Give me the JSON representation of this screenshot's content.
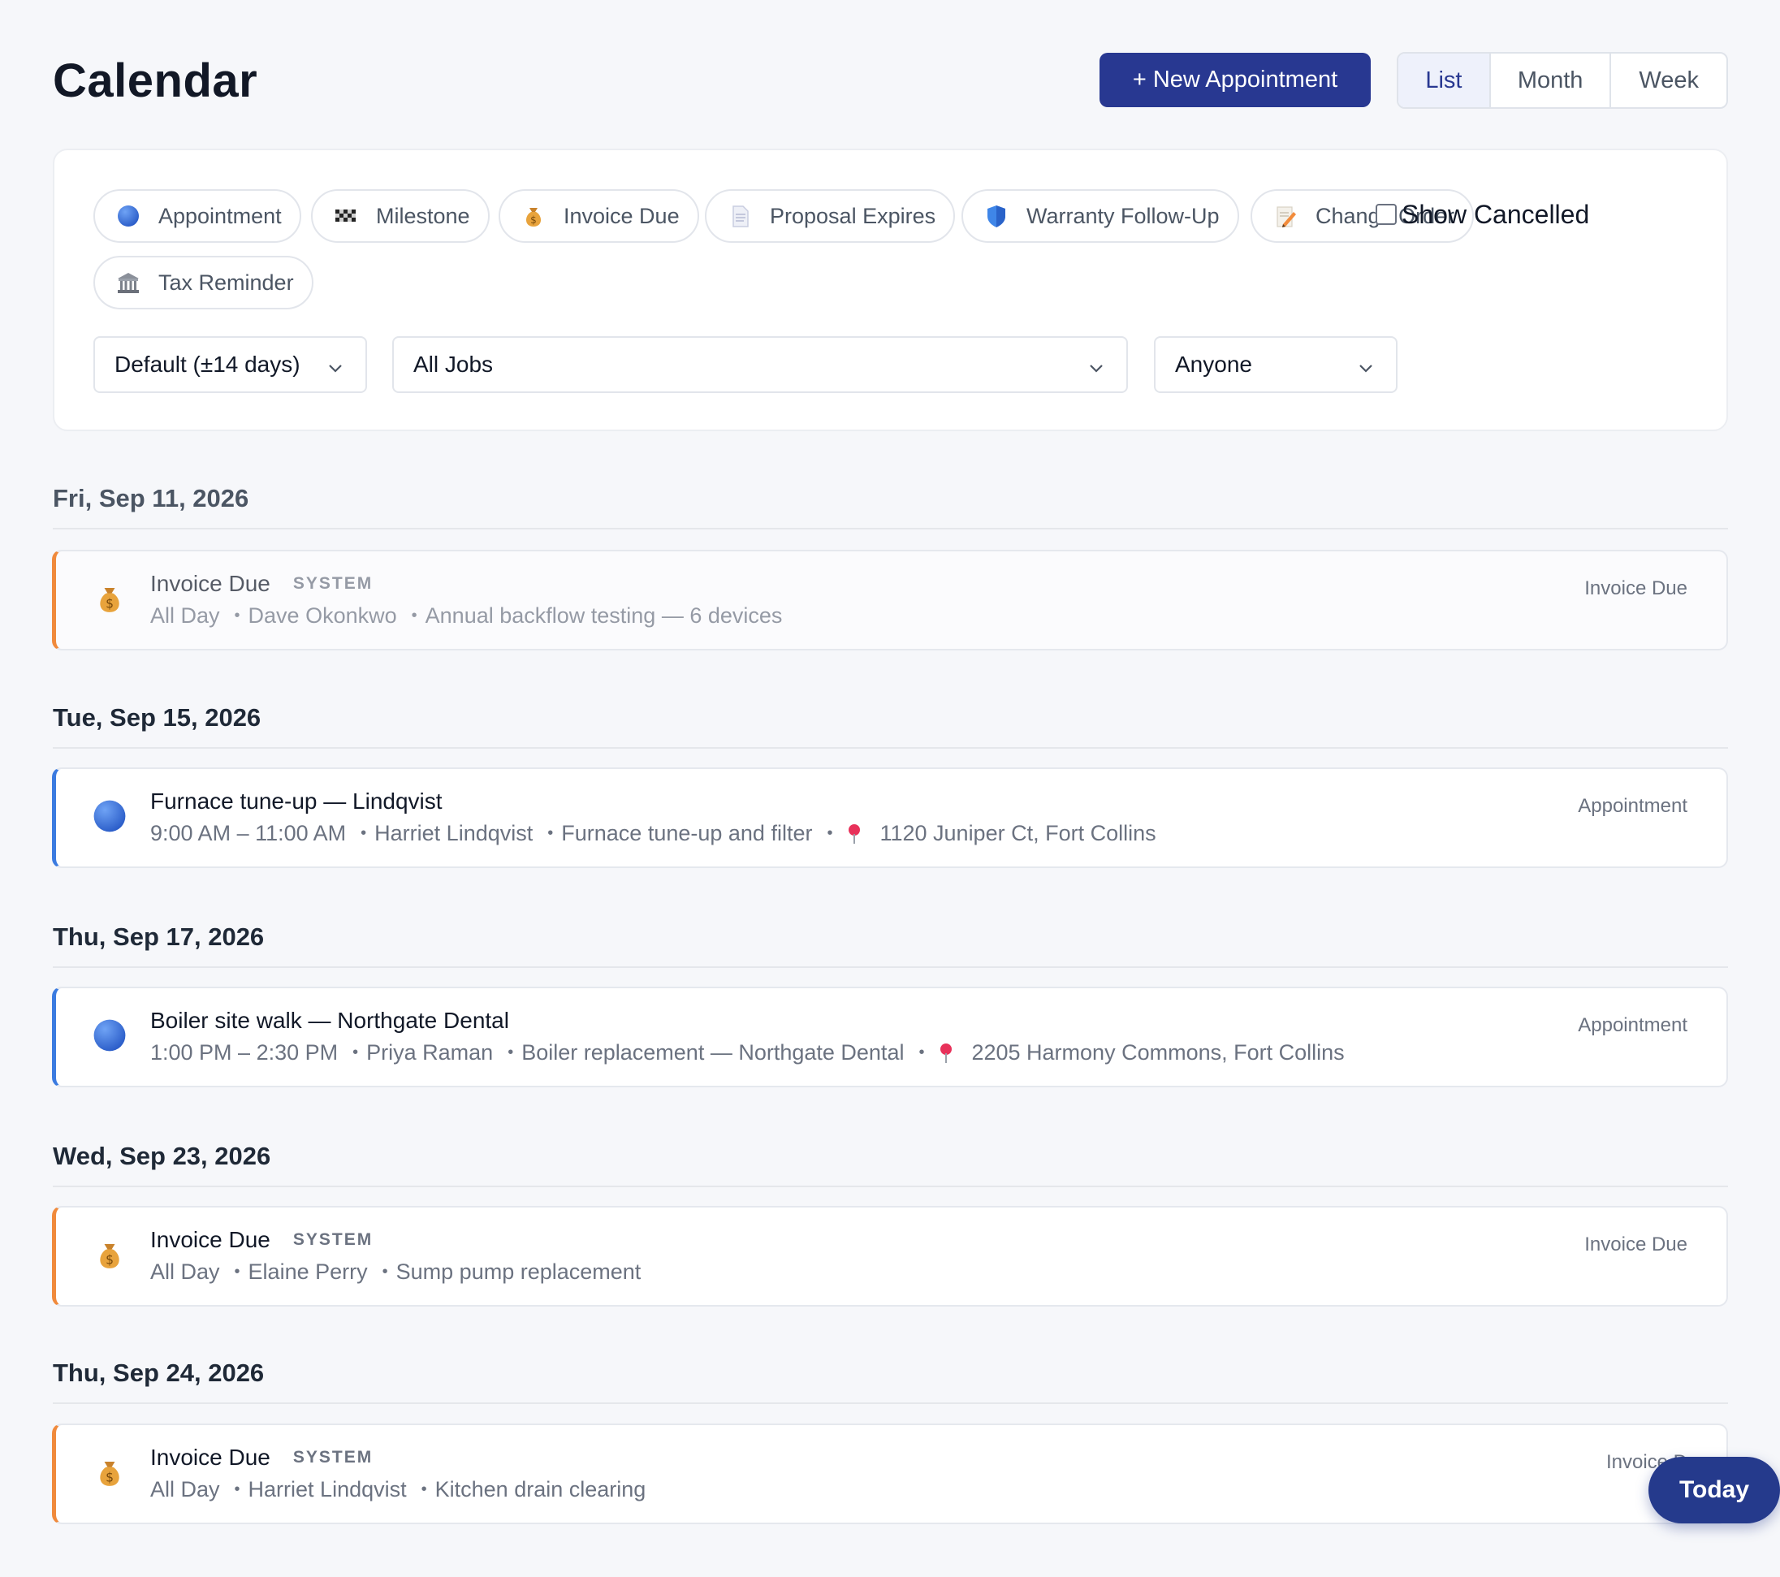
{
  "header": {
    "title": "Calendar",
    "new_button": "+ New Appointment",
    "views": [
      "List",
      "Month",
      "Week"
    ],
    "active_view": "List"
  },
  "legend": [
    {
      "label": "Appointment",
      "icon": "blue-circle-icon"
    },
    {
      "label": "Milestone",
      "icon": "checkered-flag-icon"
    },
    {
      "label": "Invoice Due",
      "icon": "money-bag-icon"
    },
    {
      "label": "Proposal Expires",
      "icon": "document-icon"
    },
    {
      "label": "Warranty Follow-Up",
      "icon": "shield-icon"
    },
    {
      "label": "Change Order",
      "icon": "memo-icon"
    },
    {
      "label": "Tax Reminder",
      "icon": "bank-icon"
    }
  ],
  "filters": {
    "range": "Default (±14 days)",
    "jobs": "All Jobs",
    "assignee": "Anyone",
    "show_cancelled": "Show Cancelled"
  },
  "groups": [
    {
      "date": "Fri, Sep 11, 2026",
      "events": [
        {
          "title": "Invoice Due",
          "badge": "SYSTEM",
          "time": "All Day",
          "person": "Dave Okonkwo",
          "job": "Annual backflow testing — 6 devices",
          "type": "Invoice Due"
        }
      ]
    },
    {
      "date": "Tue, Sep 15, 2026",
      "events": [
        {
          "title": "Furnace tune-up — Lindqvist",
          "time": "9:00 AM – 11:00 AM",
          "person": "Harriet Lindqvist",
          "job": "Furnace tune-up and filter",
          "location": "1120 Juniper Ct, Fort Collins",
          "type": "Appointment"
        }
      ]
    },
    {
      "date": "Thu, Sep 17, 2026",
      "events": [
        {
          "title": "Boiler site walk — Northgate Dental",
          "time": "1:00 PM – 2:30 PM",
          "person": "Priya Raman",
          "job": "Boiler replacement — Northgate Dental",
          "location": "2205 Harmony Commons, Fort Collins",
          "type": "Appointment"
        }
      ]
    },
    {
      "date": "Wed, Sep 23, 2026",
      "events": [
        {
          "title": "Invoice Due",
          "badge": "SYSTEM",
          "time": "All Day",
          "person": "Elaine Perry",
          "job": "Sump pump replacement",
          "type": "Invoice Due"
        }
      ]
    },
    {
      "date": "Thu, Sep 24, 2026",
      "events": [
        {
          "title": "Invoice Due",
          "badge": "SYSTEM",
          "time": "All Day",
          "person": "Harriet Lindqvist",
          "job": "Kitchen drain clearing",
          "type": "Invoice D"
        }
      ]
    }
  ],
  "today_button": "Today",
  "colors": {
    "primary": "#283891",
    "appointment": "#3b7be0",
    "invoice": "#f08a3c"
  }
}
